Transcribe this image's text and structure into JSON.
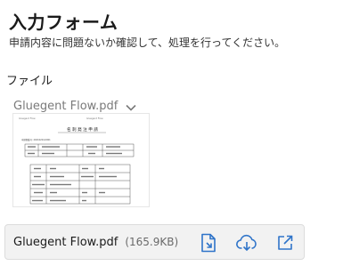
{
  "form": {
    "title": "入力フォーム",
    "description": "申請内容に問題ないか確認して、処理を行ってください。"
  },
  "file_field": {
    "label": "ファイル",
    "selected_file": "Gluegent Flow.pdf",
    "dropdown_icon": "chevron-down-icon"
  },
  "preview": {
    "header_left": "Gluegent Flow",
    "header_right": "Gluegent Flow",
    "document_title": "名 刺 発 注 申 請",
    "subheading": "申請書番号: 20210224-0001"
  },
  "attachment": {
    "file_name": "Gluegent Flow.pdf",
    "file_size": "(165.9KB)",
    "actions": [
      {
        "icon": "file-download-icon"
      },
      {
        "icon": "cloud-download-icon"
      },
      {
        "icon": "open-external-icon"
      }
    ]
  },
  "colors": {
    "accent": "#2f74c9",
    "muted_text": "#7a7a7a",
    "bar_background": "#f2f2f2"
  }
}
